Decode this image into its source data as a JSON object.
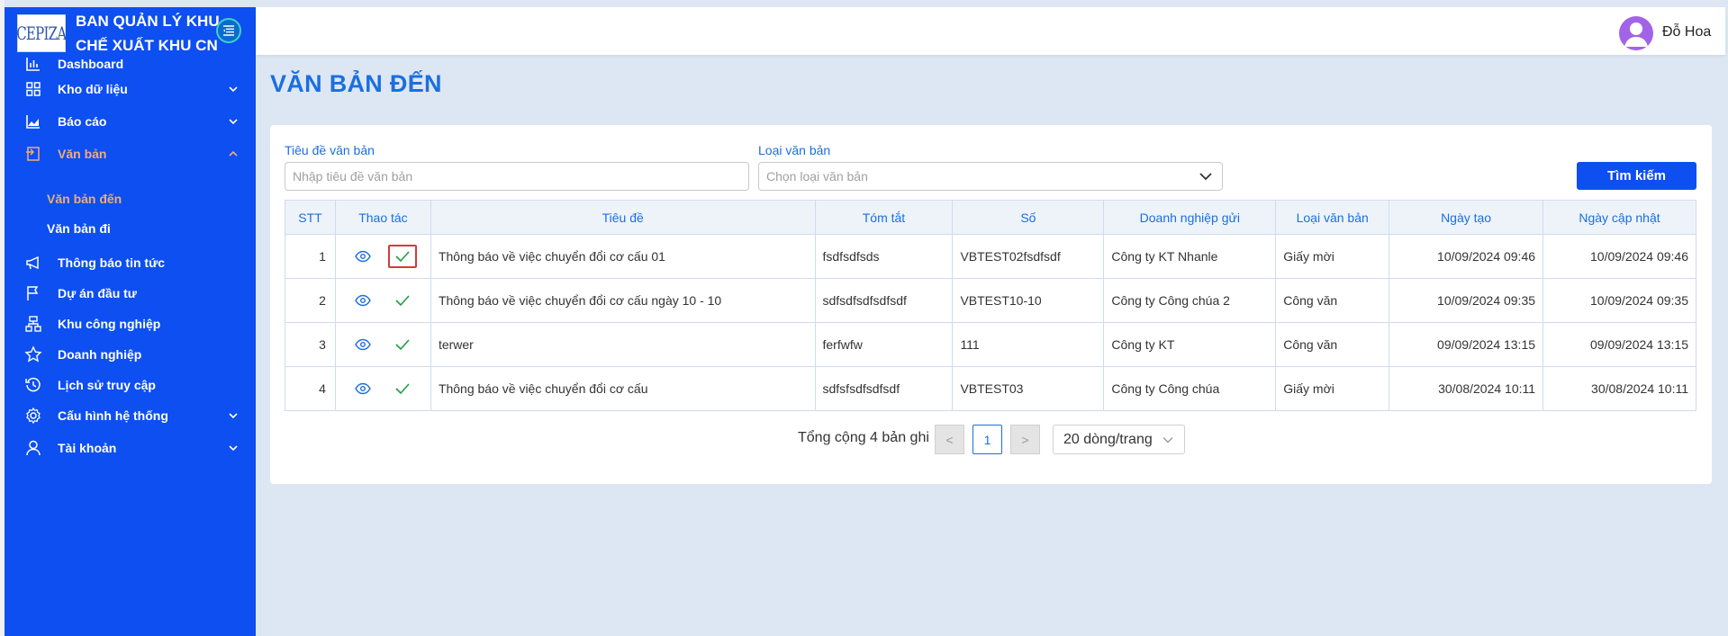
{
  "sidebar": {
    "logo_text": "CEPIZA",
    "org_name_line1": "BAN QUẢN LÝ KHU",
    "org_name_line2": "CHẾ XUẤT KHU CN",
    "items": [
      {
        "label": "Dashboard",
        "icon": "chart-bar-icon"
      },
      {
        "label": "Kho dữ liệu",
        "icon": "grid-icon"
      },
      {
        "label": "Báo cáo",
        "icon": "area-chart-icon"
      },
      {
        "label": "Văn bản",
        "icon": "document-icon"
      },
      {
        "label": "Thông báo tin tức",
        "icon": "megaphone-icon"
      },
      {
        "label": "Dự án đầu tư",
        "icon": "flag-icon"
      },
      {
        "label": "Khu công nghiệp",
        "icon": "cluster-icon"
      },
      {
        "label": "Doanh nghiệp",
        "icon": "star-icon"
      },
      {
        "label": "Lịch sử truy cập",
        "icon": "history-icon"
      },
      {
        "label": "Cấu hình hệ thống",
        "icon": "gear-icon"
      },
      {
        "label": "Tài khoản",
        "icon": "user-icon"
      }
    ],
    "sub_items": [
      {
        "label": "Văn bản đến"
      },
      {
        "label": "Văn bản đi"
      }
    ]
  },
  "header": {
    "username": "Đỗ Hoa"
  },
  "main": {
    "title": "VĂN BẢN ĐẾN",
    "filters": {
      "title_label": "Tiêu đề văn bản",
      "title_placeholder": "Nhập tiêu đề văn bản",
      "type_label": "Loại văn bản",
      "type_placeholder": "Chọn loại văn bản",
      "search_button": "Tìm kiếm"
    },
    "table": {
      "columns": [
        "STT",
        "Thao tác",
        "Tiêu đề",
        "Tóm tắt",
        "Số",
        "Doanh nghiệp gửi",
        "Loại văn bản",
        "Ngày tạo",
        "Ngày cập nhật"
      ],
      "rows": [
        {
          "stt": "1",
          "title": "Thông báo về việc chuyển đổi cơ cấu 01",
          "summary": "fsdfsdfsds",
          "number": "VBTEST02fsdfsdf",
          "company": "Công ty KT Nhanle",
          "type": "Giấy mời",
          "created": "10/09/2024 09:46",
          "updated": "10/09/2024 09:46"
        },
        {
          "stt": "2",
          "title": "Thông báo về việc chuyển đổi cơ cấu ngày 10 - 10",
          "summary": "sdfsdfsdfsdfsdf",
          "number": "VBTEST10-10",
          "company": "Công ty Công chúa 2",
          "type": "Công văn",
          "created": "10/09/2024 09:35",
          "updated": "10/09/2024 09:35"
        },
        {
          "stt": "3",
          "title": "terwer",
          "summary": "ferfwfw",
          "number": "111",
          "company": "Công ty KT",
          "type": "Công văn",
          "created": "09/09/2024 13:15",
          "updated": "09/09/2024 13:15"
        },
        {
          "stt": "4",
          "title": "Thông báo về việc chuyển đổi cơ cấu",
          "summary": "sdfsfsdfsdfsdf",
          "number": "VBTEST03",
          "company": "Công ty Công chúa",
          "type": "Giấy mời",
          "created": "30/08/2024 10:11",
          "updated": "30/08/2024 10:11"
        }
      ]
    },
    "pagination": {
      "total": "Tổng cộng 4 bản ghi",
      "prev": "<",
      "current": "1",
      "next": ">",
      "page_size": "20 dòng/trang"
    }
  },
  "colors": {
    "sidebar_bg": "#0d4ff0",
    "accent": "#1b6fe0",
    "active_menu": "#f0ad76",
    "view_icon": "#1b6fe0",
    "approve_icon": "#1e9e3e",
    "highlight_border": "#d33b3b"
  }
}
